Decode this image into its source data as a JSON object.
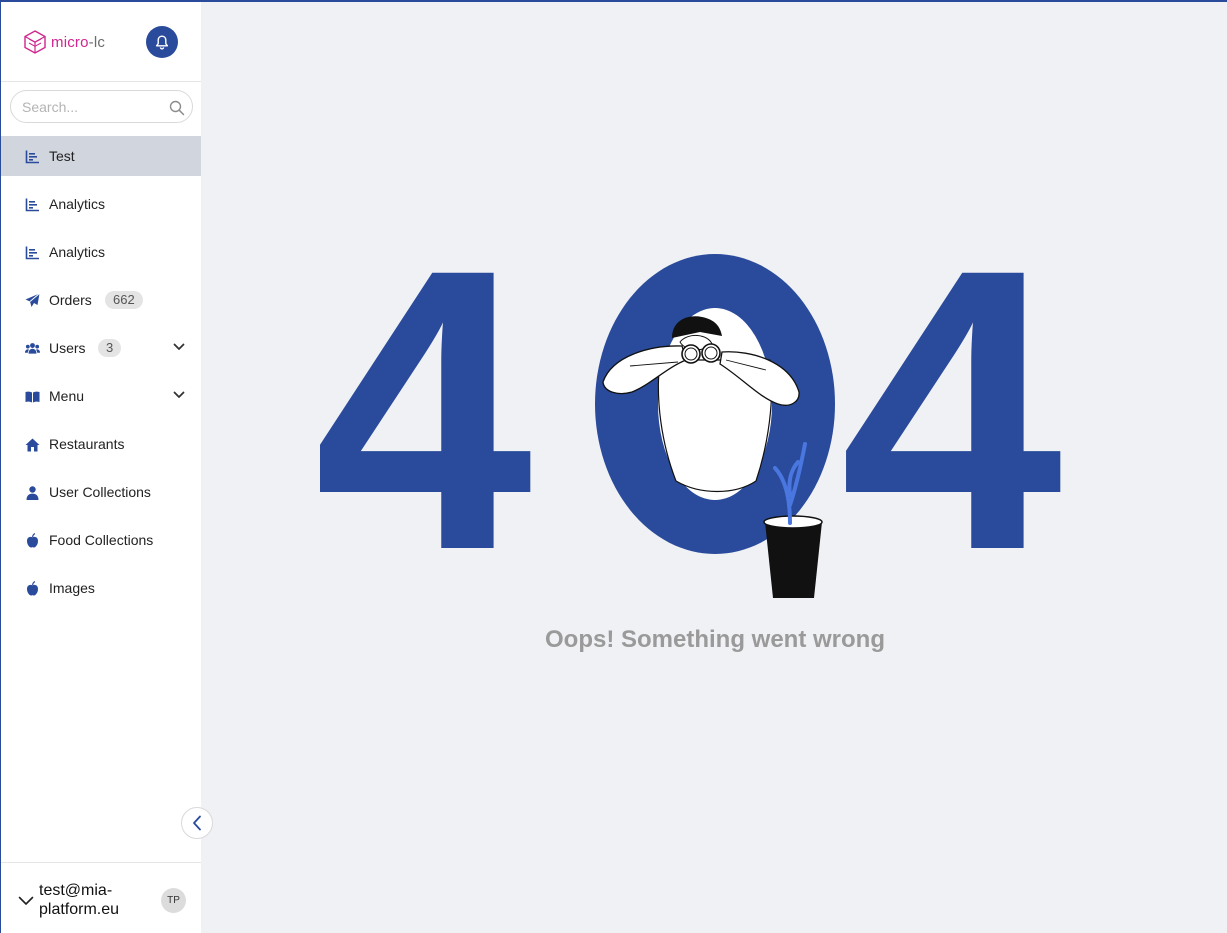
{
  "app": {
    "logo_text_main": "micro",
    "logo_text_rest": "-lc"
  },
  "header": {
    "notifications_icon": "bell-icon"
  },
  "search": {
    "placeholder": "Search...",
    "icon": "search-icon"
  },
  "menu": {
    "items": [
      {
        "label": "Test",
        "icon": "bar-chart-icon",
        "active": true
      },
      {
        "label": "Analytics",
        "icon": "bar-chart-icon"
      },
      {
        "label": "Analytics",
        "icon": "bar-chart-icon"
      },
      {
        "label": "Orders",
        "icon": "paper-plane-icon",
        "badge": "662"
      },
      {
        "label": "Users",
        "icon": "users-icon",
        "badge": "3",
        "expandable": true
      },
      {
        "label": "Menu",
        "icon": "book-icon",
        "expandable": true
      },
      {
        "label": "Restaurants",
        "icon": "home-icon"
      },
      {
        "label": "User Collections",
        "icon": "user-icon"
      },
      {
        "label": "Food Collections",
        "icon": "apple-icon"
      },
      {
        "label": "Images",
        "icon": "apple-icon"
      }
    ]
  },
  "user": {
    "email": "test@mia-platform.eu",
    "initials": "TP"
  },
  "error": {
    "code": "404",
    "message": "Oops! Something went wrong"
  },
  "colors": {
    "accent": "#2a4b9b",
    "brand_pink": "#d0258f",
    "active_bg": "#d1d6de",
    "message": "#9a9a9a"
  }
}
